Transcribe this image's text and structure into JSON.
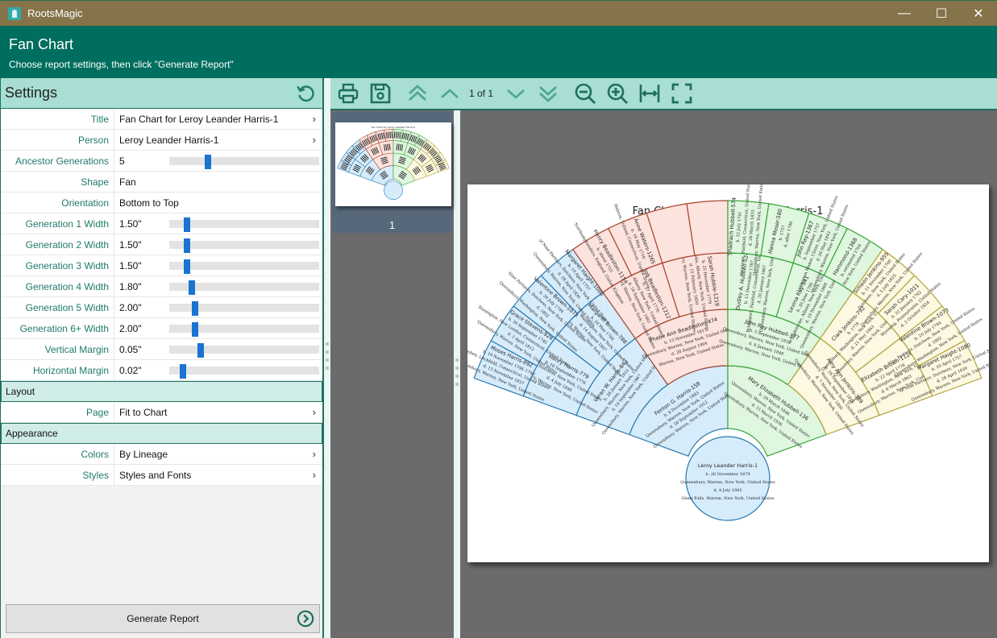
{
  "window": {
    "app_title": "RootsMagic",
    "controls": {
      "minimize": "—",
      "maximize": "☐",
      "close": "✕"
    }
  },
  "header": {
    "title": "Fan Chart",
    "subtitle": "Choose report settings, then click \"Generate Report\""
  },
  "settings": {
    "title": "Settings",
    "reset_icon": "undo-icon",
    "rows": [
      {
        "label": "Title",
        "value": "Fan Chart for Leroy Leander Harris-1",
        "type": "link"
      },
      {
        "label": "Person",
        "value": "Leroy Leander Harris-1",
        "type": "link"
      },
      {
        "label": "Ancestor Generations",
        "value": "5",
        "type": "slider",
        "fraction": 0.26
      },
      {
        "label": "Shape",
        "value": "Fan",
        "type": "select"
      },
      {
        "label": "Orientation",
        "value": "Bottom to Top",
        "type": "select"
      },
      {
        "label": "Generation 1 Width",
        "value": "1.50\"",
        "type": "slider",
        "fraction": 0.12
      },
      {
        "label": "Generation 2 Width",
        "value": "1.50\"",
        "type": "slider",
        "fraction": 0.12
      },
      {
        "label": "Generation 3 Width",
        "value": "1.50\"",
        "type": "slider",
        "fraction": 0.12
      },
      {
        "label": "Generation 4 Width",
        "value": "1.80\"",
        "type": "slider",
        "fraction": 0.15
      },
      {
        "label": "Generation 5 Width",
        "value": "2.00\"",
        "type": "slider",
        "fraction": 0.17
      },
      {
        "label": "Generation 6+ Width",
        "value": "2.00\"",
        "type": "slider",
        "fraction": 0.17
      },
      {
        "label": "Vertical Margin",
        "value": "0.05\"",
        "type": "slider",
        "fraction": 0.21
      },
      {
        "label": "Horizontal Margin",
        "value": "0.02\"",
        "type": "slider",
        "fraction": 0.09
      }
    ],
    "layout_section": "Layout",
    "layout_rows": [
      {
        "label": "Page",
        "value": "Fit to Chart",
        "type": "link"
      }
    ],
    "appearance_section": "Appearance",
    "appearance_rows": [
      {
        "label": "Colors",
        "value": "By Lineage",
        "type": "link"
      },
      {
        "label": "Styles",
        "value": "Styles and Fonts",
        "type": "link"
      }
    ],
    "generate_button": "Generate Report"
  },
  "toolbar": {
    "buttons": [
      "print-icon",
      "save-icon",
      "first-page-icon",
      "previous-page-icon",
      "next-page-icon",
      "last-page-icon",
      "zoom-out-icon",
      "zoom-in-icon",
      "fit-width-icon",
      "fit-page-icon"
    ],
    "page_indicator": "1 of 1"
  },
  "thumbnails": [
    {
      "page_number": "1",
      "selected": true
    }
  ],
  "colors": {
    "accent": "#006e5e",
    "titlebar": "#85744a",
    "panel_head": "#a8ded3",
    "lineage_blue": "#d6ecfb",
    "lineage_red": "#fde3dd",
    "lineage_green": "#dff6df",
    "lineage_yellow": "#fdf8e1"
  },
  "fan_chart": {
    "title": "Fan Chart for Leroy Leander Harris-1",
    "root": {
      "name": "Leroy Leander Harris-1",
      "lines": [
        "b. 26 November 1879",
        "Queensbury, Warren, New York, United States",
        "d. 4 July 1965",
        "Glens Falls, Warren, New York, United States"
      ]
    },
    "generations": [
      [
        {
          "name": "Fenton G. Harris-158",
          "lineage": "blue",
          "lines": [
            "b. 4 December 1843",
            "Queensbury, Warren, New York, United States",
            "d. 26 September 1912",
            "Queensbury, Warren, New York, United States"
          ]
        },
        {
          "name": "Mary Elizabeth Hubbell-136",
          "lineage": "green",
          "lines": [
            "b. 29 March 1846",
            "Queensbury, Warren, New York, United States",
            "d. 15 March 1936",
            "Queensbury, Warren, New York, United States"
          ]
        }
      ],
      [
        {
          "name": "Veran W. Harris-842",
          "lineage": "blue",
          "lines": [
            "b. 28 January 1815",
            "Queensbury, Warren, New York, United States",
            "d. 14 September 1867",
            "Queensbury, Warren, New York, United States"
          ]
        },
        {
          "name": "Phebe Ann Beadleston-474",
          "lineage": "red",
          "lines": [
            "b. 15 November 1817",
            "Queensbury, Warren, New York, United States",
            "d. 20 August 1904",
            "Warren, New York, United States"
          ]
        },
        {
          "name": "John Ray Hubbell-377",
          "lineage": "green",
          "lines": [
            "b. 5 September 1813",
            "Queensbury, Warren, New York, United States",
            "d. 8 January 1848",
            "Queensbury, Warren, New York, United States"
          ]
        },
        {
          "name": "Amy Ann Jenkins-389",
          "lineage": "yellow",
          "lines": [
            "b. 28 September 1814",
            "Queensbury, Warren, New York, United States",
            "d. 7 November 1800",
            "Queensbury, Warren, New York, United States"
          ]
        }
      ],
      [
        {
          "name": "Henry Harris-779",
          "lineage": "blue",
          "lines": [
            "b. 16 September 1778",
            "Amenia, Dutchess, New York, United States",
            "d. 4 July 1846",
            "Queensbury, Warren, New York, United States"
          ]
        },
        {
          "name": "Margaret Brown-788",
          "lineage": "blue",
          "lines": [
            "b. 26 May 1784",
            "Queensbury, Washington, New York, United States",
            "d. 14 August 1867",
            "Queensbury, Warren, New York, United States"
          ]
        },
        {
          "name": "Job Beadleston-1212",
          "lineage": "red",
          "lines": [
            "b. 27 April 1776",
            "Scotia, Albany, New York, United States",
            "d. 16 September 1861",
            "Queensbury, Warren, New York, United States"
          ]
        },
        {
          "name": "Sarah Hubble-1219",
          "lineage": "red",
          "lines": [
            "b. 25 December 1779",
            "Schaghticoke, Albany, New York, United States",
            "d. 15 February 1850",
            "Queensbury, Warren, New York, United States"
          ]
        },
        {
          "name": "Dudley A. Hubbell-524",
          "lineage": "green",
          "lines": [
            "b. 13 December 1787",
            "Bridgeport, Fairfield, Connecticut, United States",
            "d. 20 January 1867",
            "Queensbury, Warren, New York, United States"
          ]
        },
        {
          "name": "Levina Ray-541",
          "lineage": "green",
          "lines": [
            "b. 30 June 1790",
            "Schaghticoke, Albany, New York, United States",
            "d. 19 November 1868",
            "Queensbury, Warren, New York, United States"
          ]
        },
        {
          "name": "Clark Jenkins-792",
          "lineage": "yellow",
          "lines": [
            "b. 1778",
            "Queensbury, Washington, New York, United States",
            "d. 21 May 1863",
            "Queensbury, Warren, New York, United States"
          ]
        },
        {
          "name": "Elizabeth Brown-1126",
          "lineage": "yellow",
          "lines": [
            "b. 22 April 1778",
            "Queensbury, Washington, New York, United States",
            "d. 6 March 1863",
            "Queensbury, Warren, New York, United States"
          ]
        }
      ],
      [
        {
          "name": "Moses Harris-892",
          "lineage": "blue",
          "lines": [
            "b. 19 November 1746–1749",
            "Goshen, Litchfield, Connecticut, United States",
            "d. 13 November 1837",
            "Queensbury, Warren, New York, United States"
          ]
        },
        {
          "name": "Grace Stevens-928",
          "lineage": "blue",
          "lines": [
            "b. 20 September 1745",
            "Stonington, New London, Connecticut, United States",
            "d. 2 April 1813",
            "Queensbury, Warren, New York, United States"
          ]
        },
        {
          "name": "Valentine Brown-1073",
          "lineage": "blue",
          "lines": [
            "b. 20 July 1744",
            "Nine Partners, Dutchess, New York, United States",
            "d. 1802",
            "Queensbury, Washington, New York, United States"
          ]
        },
        {
          "name": "Margaret Haight-1080",
          "lineage": "blue",
          "lines": [
            "b. 10 April 1757",
            "of Nine Partners, Dutchess, New York, United States",
            "d. 28 April 1830",
            "Queensbury, Warren, New York, United States"
          ]
        },
        {
          "name": "Henry Beadleston-1154",
          "lineage": "red",
          "lines": [
            "b. about 1725",
            "Northamptonshire, England, United Kingdom"
          ]
        },
        {
          "name": "Anne Waters-1265",
          "lineage": "red",
          "lines": [
            "b. 16 May 1716",
            "Hebron, Tolland, Connecticut, United States"
          ]
        },
        {
          "name": "",
          "lineage": "red",
          "lines": []
        },
        {
          "name": "",
          "lineage": "red",
          "lines": []
        },
        {
          "name": "Shadrach Hubbell-574",
          "lineage": "green",
          "lines": [
            "b. 22 July 1741",
            "Newtown, Fairfield, Connecticut, United States",
            "d. 28 March 1835",
            "Queensbury, Warren, New York, United States"
          ]
        },
        {
          "name": "Hanna Moser-580",
          "lineage": "green",
          "lines": [
            "b. 1757",
            "d. after 1796"
          ]
        },
        {
          "name": "John Ray-1367",
          "lineage": "green",
          "lines": [
            "b. September 1757",
            "Livingston Manor, Ulster, New York, United States",
            "d. 20 May 1843",
            "Queensbury, Warren, New York, United States"
          ]
        },
        {
          "name": "Hammond-1368",
          "lineage": "green",
          "lines": [
            "b. estimated 1764",
            "New York, United States"
          ]
        },
        {
          "name": "Simeon Jenkins-955",
          "lineage": "yellow",
          "lines": [
            "b. 11 November 1760",
            "Dutchess, New York, United States",
            "d. 5 July 1835",
            "Queensbury, Warren, New York, United States"
          ]
        },
        {
          "name": "Sarah Cary-1011",
          "lineage": "yellow",
          "lines": [
            "b. 22 January 1762",
            "Wyoming, Pennsylvania, United States",
            "d. 2 October 1824"
          ]
        },
        {
          "name": "Valentine Brown-1073",
          "lineage": "yellow",
          "lines": [
            "b. 20 July 1744",
            "Nine Partners, Dutchess, New York, United States",
            "d. 1802",
            "Queensbury, Washington, New York, United States"
          ]
        },
        {
          "name": "Margaret Haight-1080",
          "lineage": "yellow",
          "lines": [
            "b. 10 April 1757",
            "of Nine Partners, Dutchess, New York, United States",
            "d. 28 April 1830",
            "Queensbury, Warren, New York, United States"
          ]
        }
      ]
    ]
  }
}
